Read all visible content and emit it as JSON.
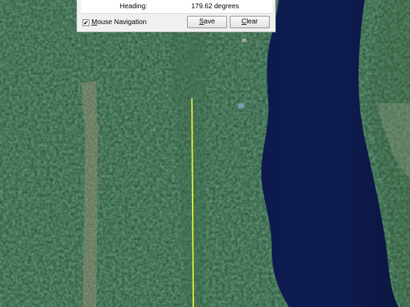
{
  "ruler": {
    "heading_label": "Heading:",
    "heading_value": "179.62 degrees",
    "mouse_navigation": {
      "label": "Mouse Navigation",
      "checked": true
    },
    "save_label": "Save",
    "clear_label": "Clear"
  },
  "colors": {
    "forest": "#24513a",
    "river": "#0e1a4a",
    "path": "#e6f03a"
  }
}
